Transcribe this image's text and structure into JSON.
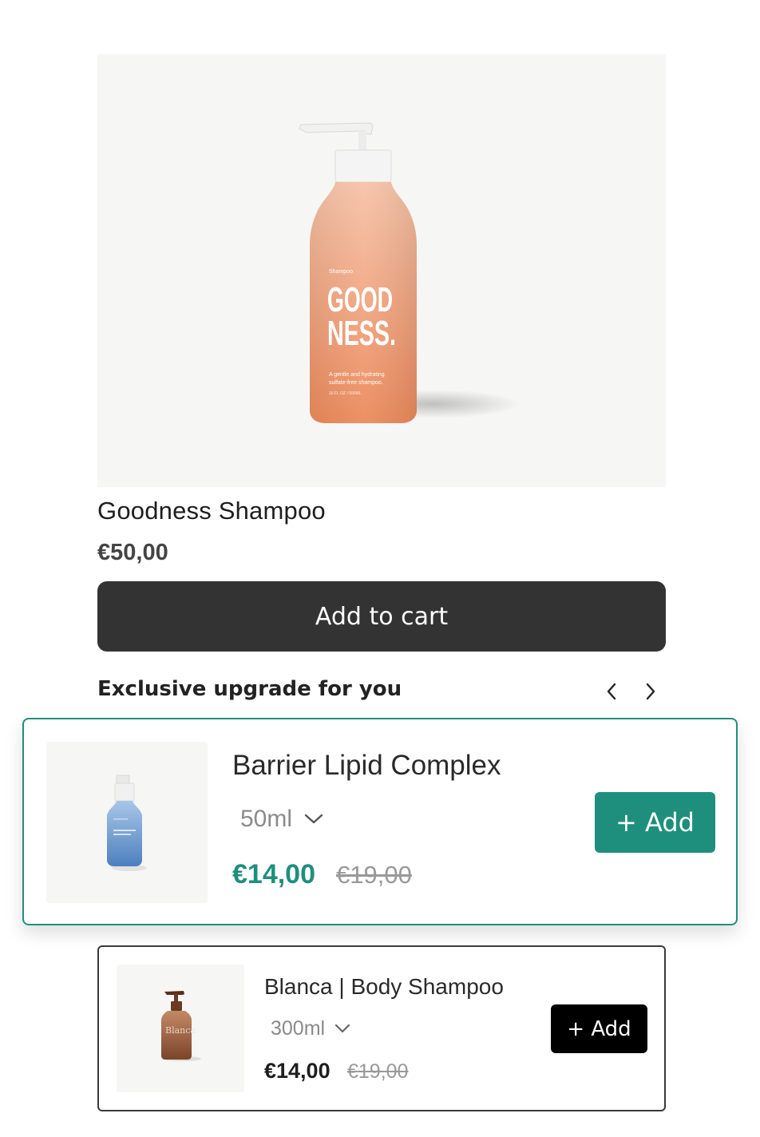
{
  "product": {
    "title": "Goodness Shampoo",
    "price": "€50,00",
    "image": {
      "label_small": "Shampoo",
      "brand_line1": "GOOD",
      "brand_line2": "NESS.",
      "tagline_line1": "A gentle and hydrating",
      "tagline_line2": "sulfate-free shampoo.",
      "volume": "16 FL OZ / 500ML"
    }
  },
  "cart": {
    "label": "Add to cart"
  },
  "upsell": {
    "heading": "Exclusive upgrade for you",
    "prev_icon": "chevron-left-icon",
    "next_icon": "chevron-right-icon",
    "items": [
      {
        "name": "Barrier Lipid Complex",
        "variant": "50ml",
        "price": "€14,00",
        "compare_price": "€19,00",
        "add_label": "+ Add",
        "accent": "#1f8f7d"
      },
      {
        "name": "Blanca | Body Shampoo",
        "variant": "300ml",
        "price": "€14,00",
        "compare_price": "€19,00",
        "add_label": "+ Add",
        "bottle_text": "Blanca"
      }
    ]
  },
  "colors": {
    "cart_button": "#333333",
    "accent": "#1f8f7d",
    "bottle": "#f0a27e"
  }
}
